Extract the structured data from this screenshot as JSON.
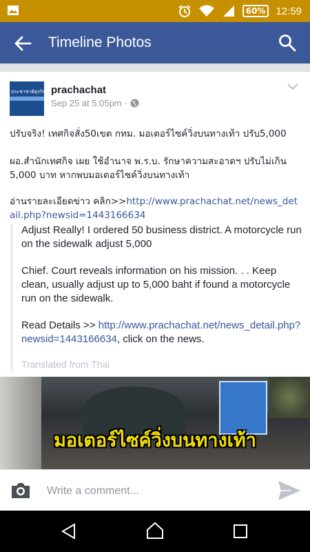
{
  "status_bar": {
    "battery": "60%",
    "time": "12:59"
  },
  "app_bar": {
    "title": "Timeline Photos"
  },
  "post": {
    "page_name": "prachachat",
    "avatar_text": "ประชาชาติธุรกิจ",
    "timestamp": "Sep 25 at 5:05pm",
    "separator": "·",
    "paragraph_1": "ปรับจริง! เทศกิจสั่ง50เขต กทม. มอเตอร์ไซค์วิ่งบนทางเท้า ปรับ5,000",
    "paragraph_2": "ผอ.สำนักเทศกิจ เผย ใช้อำนาจ พ.ร.บ. รักษาความสะอาดฯ ปรับไม่เกิน 5,000 บาท หากพบมอเตอร์ไซค์วิ่งบนทางเท้า",
    "paragraph_3_prefix": "อ่านรายละเอียดข่าว คลิก>>",
    "paragraph_3_link": "http://www.prachachat.net/news_detail.php?newsid=1443166634"
  },
  "translation": {
    "para_1": "Adjust Really! I ordered 50 business district. A motorcycle run on the sidewalk adjust 5,000",
    "para_2": "Chief. Court reveals information on his mission. . . Keep clean, usually adjust up to 5,000 baht if found a motorcycle run on the sidewalk.",
    "para_3_prefix": "Read Details >> ",
    "para_3_link": "http://www.prachachat.net/news_detail.php?newsid=1443166634",
    "para_3_suffix": ", click on the news.",
    "note": "Translated from Thai"
  },
  "image": {
    "caption": "มอเตอร์ไซค์วิ่งบนทางเท้า"
  },
  "comment_bar": {
    "placeholder": "Write a comment..."
  },
  "colors": {
    "status_bar": "#c69000",
    "app_bar": "#3b5998",
    "link": "#365899"
  }
}
